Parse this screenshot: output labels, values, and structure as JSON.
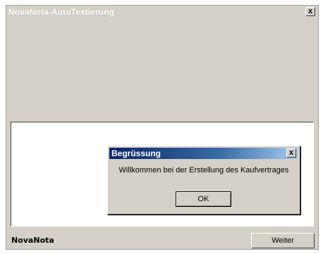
{
  "window": {
    "title": "NovaNota-AutoTextierung",
    "close_label": "x"
  },
  "dialog": {
    "title": "Begrüssung",
    "close_label": "x",
    "message": "Willkommen bei der Erstellung des Kaufvertrages",
    "ok_label": "OK"
  },
  "footer": {
    "brand": "NovaNota",
    "next_label": "Weiter"
  },
  "colors": {
    "dialog_title_start": "#0a246a",
    "dialog_title_end": "#a6caf0",
    "window_bg": "#d4d0c8"
  }
}
